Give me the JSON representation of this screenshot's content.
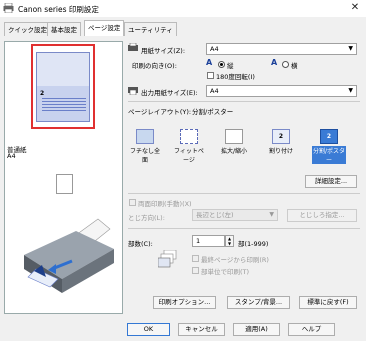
{
  "window": {
    "title": "Canon          series 印刷設定",
    "close_glyph": "✕"
  },
  "tabs": [
    {
      "label": "クイック設定"
    },
    {
      "label": "基本設定"
    },
    {
      "label": "ページ設定"
    },
    {
      "label": "ユーティリティ"
    }
  ],
  "left_panel": {
    "media": "普通紙",
    "size": "A4"
  },
  "page_setup": {
    "paper_size_label": "用紙サイズ(Z):",
    "paper_size_value": "A4",
    "orientation_label": "印刷の向き(O):",
    "portrait_label": "縦",
    "landscape_label": "横",
    "rotate180_label": "180度回転(I)",
    "output_size_label": "出力用紙サイズ(E):",
    "output_size_value": "A4",
    "layout_label": "ページレイアウト(Y):",
    "layout_value": "分割/ポスター",
    "layout_items": [
      {
        "label": "フチなし全面"
      },
      {
        "label": "フィットページ"
      },
      {
        "label": "拡大/縮小"
      },
      {
        "label": "割り付け"
      },
      {
        "label": "分割/ポスター"
      }
    ],
    "detail_button": "詳細設定...",
    "duplex_label": "両面印刷(手動)(X)",
    "binding_side_label": "とじ方向(L):",
    "binding_side_value": "長辺とじ(左)",
    "margin_button": "とじしろ指定...",
    "copies_label": "部数(C):",
    "copies_value": "1",
    "copies_range": "部(1-999)",
    "last_page_first_label": "最終ページから印刷(R)",
    "collate_label": "部単位で印刷(T)",
    "print_options_button": "印刷オプション...",
    "stamp_button": "スタンプ/背景...",
    "defaults_button": "標準に戻す(F)"
  },
  "footer": {
    "ok": "OK",
    "cancel": "キャンセル",
    "apply": "適用(A)",
    "help": "ヘルプ"
  }
}
